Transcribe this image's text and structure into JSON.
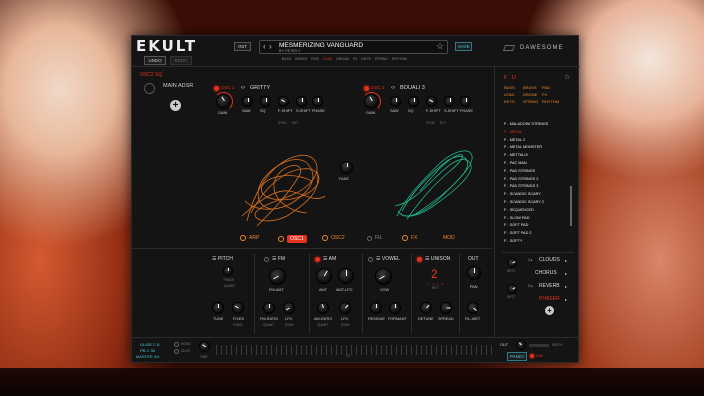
{
  "brand": {
    "logo": "EKULT",
    "vendor": "DAWESOME"
  },
  "header": {
    "undo": "UNDO",
    "redo": "REDO",
    "init": "INIT",
    "preset_name": "MESMERIZING VANGUARD",
    "preset_author": "BY: PETER V",
    "save": "SAVE",
    "categories": [
      "BASS",
      "BRASS",
      "FIXE",
      "LEAD",
      "ORGAN",
      "FX",
      "KEYS",
      "STRING",
      "RHYTHM"
    ]
  },
  "osc_label": "OSC2 SQ",
  "main_adsr": "MAIN ADSR",
  "osc1": {
    "name": "OSC 1",
    "wave": "GRITTY",
    "knobs": [
      "GAIN",
      "SAW",
      "SQ",
      "F-SHIFT",
      "S-SHIFT",
      "PHASE"
    ],
    "subs": [
      "SYNC",
      "EXT"
    ]
  },
  "osc2": {
    "name": "OSC 2",
    "wave": "BOUALI 3",
    "knobs": [
      "GAIN",
      "SAW",
      "SQ",
      "F-SHIFT",
      "S-SHIFT",
      "PHASE"
    ],
    "subs": [
      "SYNC",
      "EXT"
    ]
  },
  "fade": "FADE",
  "tabs": [
    "ARP",
    "OSC1",
    "OSC2",
    "FIL",
    "FX",
    "MOD"
  ],
  "modules": {
    "pitch": {
      "title": "PITCH",
      "k1": "TRANS.",
      "sub": "QUANT",
      "k2": "TUNE",
      "k3": "FIXED",
      "sub2": "FIXED"
    },
    "fm": {
      "title": "FM",
      "k1": "FM-AMT",
      "k2": "FM-RATIO",
      "k3": "LFO",
      "sub": "QUANT",
      "sub2": "SYNC"
    },
    "am": {
      "title": "AM",
      "k1": "AMT",
      "k2": "AMT-LFO",
      "k3": "AM-RATIO",
      "k4": "LFO",
      "sub": "QUANT",
      "sub2": "SYNC"
    },
    "vowel": {
      "title": "VOWEL",
      "k1": "VOW",
      "k2": "RESIDUE",
      "k3": "FORMANT"
    },
    "unison": {
      "title": "UNISON",
      "voices": "2",
      "sub": "RET",
      "k1": "DETUNE",
      "k2": "SPREAD"
    },
    "out": {
      "title": "OUT",
      "k1": "PAN",
      "k2": "FIL-WET"
    }
  },
  "footer": {
    "glide": "GLIDE C 8",
    "pb": "PB C 36",
    "master": "MASTER 4/4",
    "mono": "MONO",
    "gliss": "GLISS",
    "time": "TIME",
    "c3": "C3",
    "out": "OUT",
    "panic": "PANIC!",
    "lim": "LIM",
    "width": "WIDTH"
  },
  "browser": {
    "filters": [
      "BASS",
      "BRASS",
      "PAD",
      "LEAD",
      "DRONE",
      "FX",
      "KEYS",
      "STRING",
      "RHYTHM"
    ],
    "fu": "F U",
    "presets": [
      "F - MALADOWI STRINGS",
      "F - METAL",
      "F - METAL 2",
      "F - METAL MONSTER",
      "F - METTALIX",
      "F - PAC MAN",
      "F - PAD STRINGS",
      "F - PAD STRINGS 2",
      "F - PAD STRINGS 3",
      "F - SCANDIC SCARY",
      "F - SCANDIC SCARY 2",
      "F - SEQUENCED",
      "F - SLOW PAD",
      "F - SOFT PAD",
      "F - SOFT PAD 2",
      "F - SOFTY"
    ]
  },
  "fxchain": {
    "items": [
      "CLOUDS",
      "CHORUS",
      "REVERB",
      "PHASER"
    ],
    "sends": [
      "SEND 1",
      "SEND 2"
    ],
    "k1": "NRT1",
    "k2": "NRT2"
  }
}
